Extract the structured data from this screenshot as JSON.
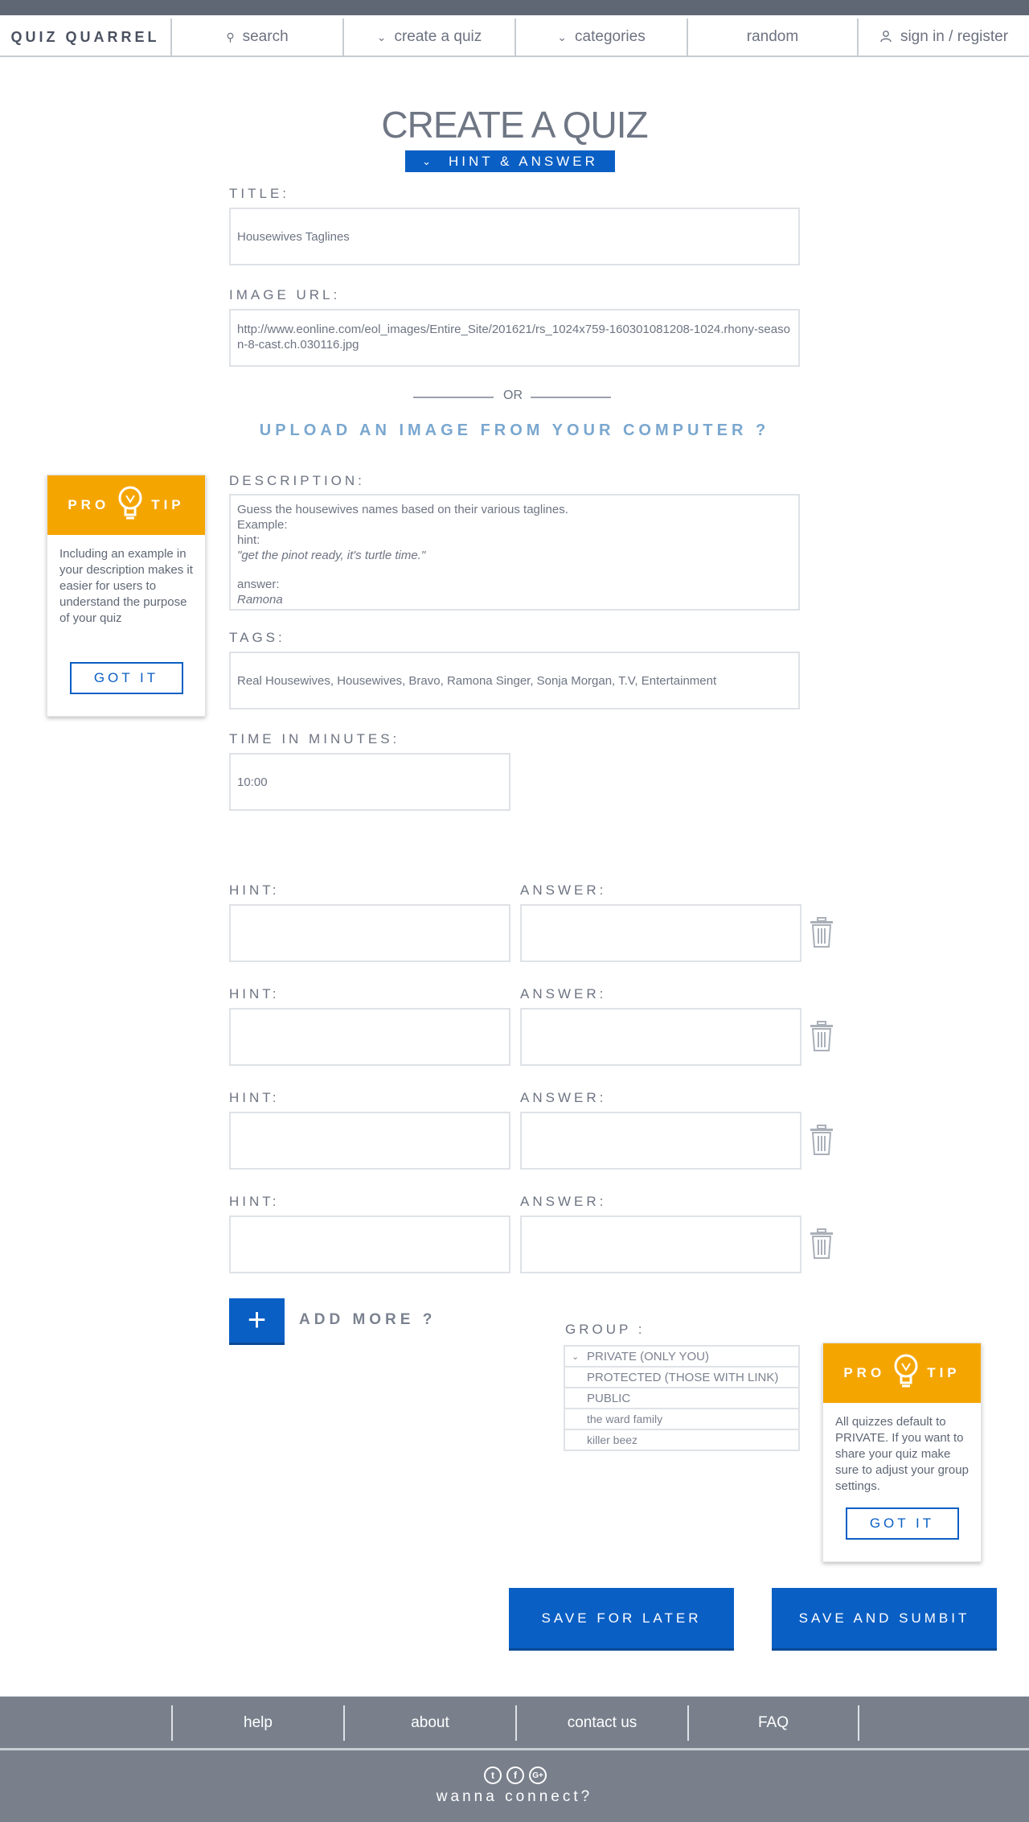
{
  "nav": {
    "logo": "QUIZ QUARREL",
    "search": "search",
    "create": "create a quiz",
    "categories": "categories",
    "random": "random",
    "signin": "sign in / register"
  },
  "page": {
    "title": "CREATE A QUIZ",
    "mode": "HINT & ANSWER"
  },
  "form": {
    "title_label": "TITLE:",
    "title_value": "Housewives Taglines",
    "image_label": "IMAGE URL:",
    "image_value": "http://www.eonline.com/eol_images/Entire_Site/201621/rs_1024x759-160301081208-1024.rhony-season-8-cast.ch.030116.jpg",
    "or": "OR",
    "upload": "UPLOAD AN IMAGE FROM YOUR COMPUTER ?",
    "description_label": "DESCRIPTION:",
    "description": {
      "line1": "Guess the housewives names based on their various taglines.",
      "line2": "Example:",
      "line3": "hint:",
      "line4": "\"get the pinot ready, it's turtle time.\"",
      "line5": "answer:",
      "line6": "Ramona"
    },
    "tags_label": "TAGS:",
    "tags_value": "Real Housewives, Housewives, Bravo, Ramona Singer, Sonja Morgan, T.V, Entertainment",
    "time_label": "TIME IN MINUTES:",
    "time_value": "10:00"
  },
  "pairs": {
    "hint_label": "HINT:",
    "answer_label": "ANSWER:",
    "rows": [
      {
        "hint": "",
        "answer": ""
      },
      {
        "hint": "",
        "answer": ""
      },
      {
        "hint": "",
        "answer": ""
      },
      {
        "hint": "",
        "answer": ""
      }
    ],
    "add_more": "ADD MORE ?",
    "add_symbol": "+"
  },
  "group": {
    "label": "GROUP :",
    "options": [
      "PRIVATE (ONLY YOU)",
      "PROTECTED (THOSE WITH LINK)",
      "PUBLIC",
      "the ward family",
      "killer beez"
    ]
  },
  "tips": {
    "pro": "PRO",
    "tip": "TIP",
    "tip1": "Including an example in your description makes it easier for users to understand the purpose of your quiz",
    "tip2": "All quizzes default to PRIVATE. If you want to share your quiz make sure to adjust your group settings.",
    "got_it": "GOT IT"
  },
  "actions": {
    "save_later": "SAVE FOR LATER",
    "save_submit": "SAVE AND SUMBIT"
  },
  "footer": {
    "help": "help",
    "about": "about",
    "contact": "contact us",
    "faq": "FAQ",
    "connect": "wanna connect?"
  },
  "icons": [
    "search-icon",
    "chevron-down-icon",
    "user-icon",
    "lightbulb-icon",
    "trash-icon",
    "plus-icon",
    "twitter-icon",
    "facebook-icon",
    "google-plus-icon"
  ],
  "colors": {
    "primary": "#0a5fc4",
    "tip": "#f5a500",
    "upload": "#7aa7cf",
    "footer": "#79808c"
  }
}
